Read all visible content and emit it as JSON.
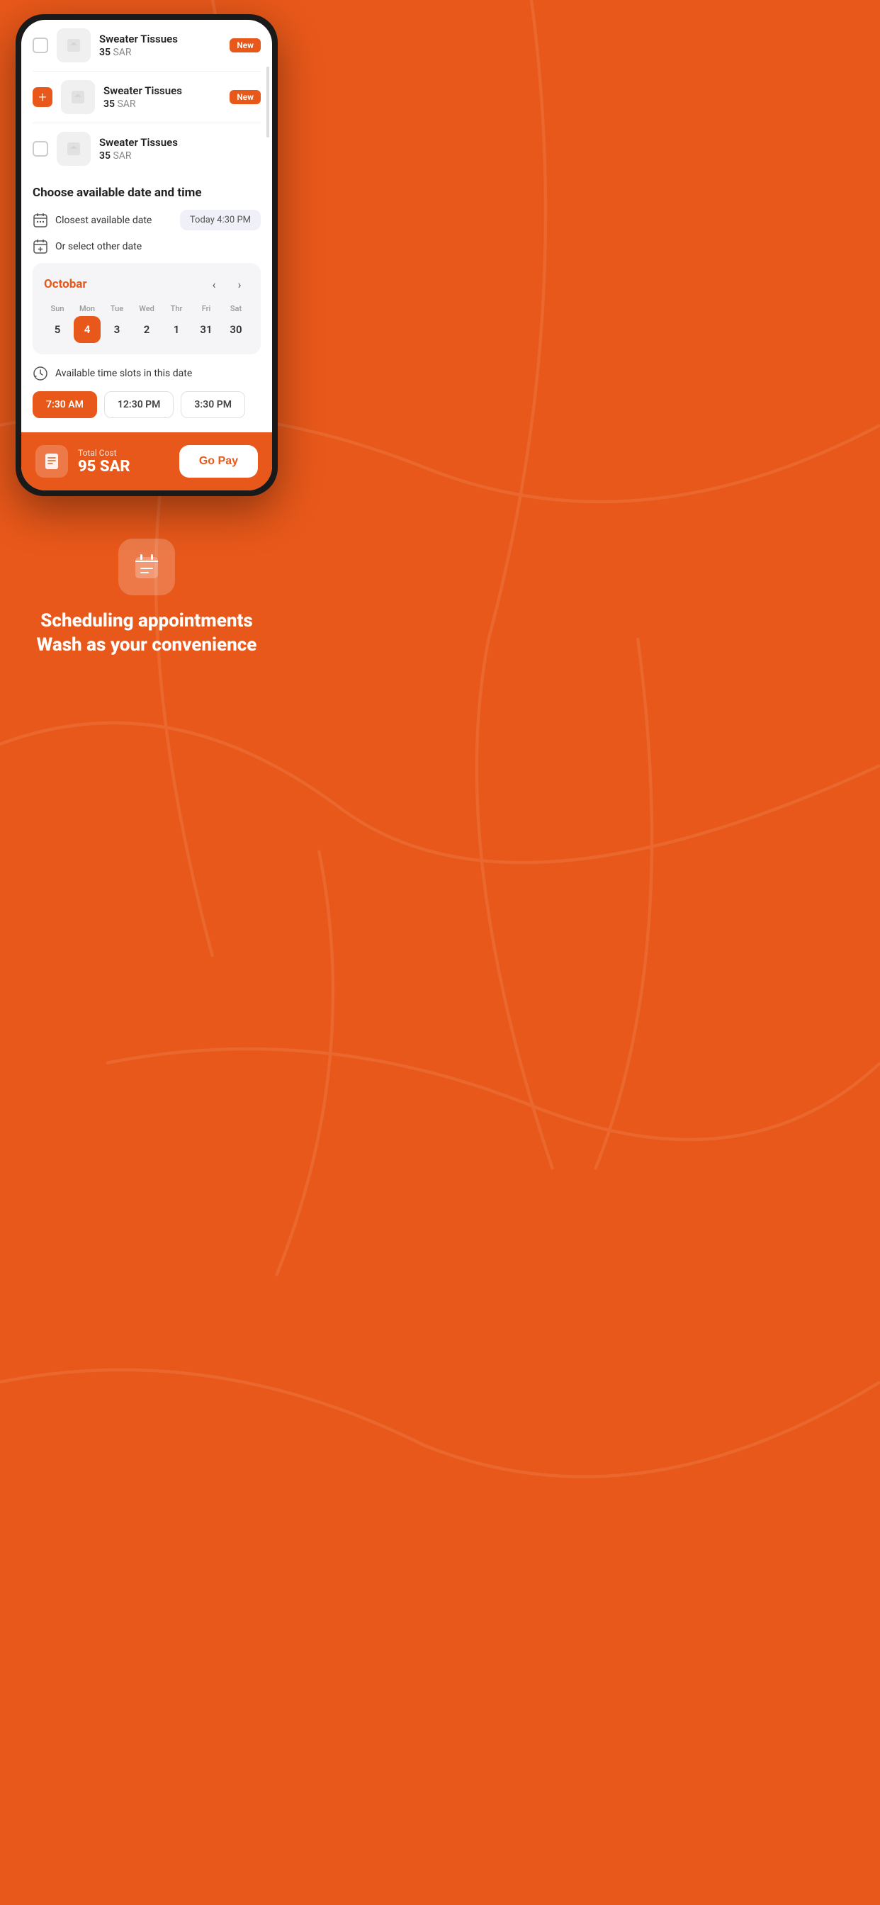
{
  "background_color": "#E8581A",
  "products": [
    {
      "name": "Sweater Tissues",
      "price": "35",
      "currency": "SAR",
      "has_checkbox": true,
      "has_add": false,
      "is_new": true,
      "show_badge": true
    },
    {
      "name": "Sweater Tissues",
      "price": "35",
      "currency": "SAR",
      "has_checkbox": false,
      "has_add": true,
      "is_new": true,
      "show_badge": true
    },
    {
      "name": "Sweater Tissues",
      "price": "35",
      "currency": "SAR",
      "has_checkbox": true,
      "has_add": false,
      "is_new": false,
      "show_badge": false
    }
  ],
  "date_section": {
    "title": "Choose available date and time",
    "closest_label": "Closest available date",
    "closest_value": "Today 4:30 PM",
    "other_date_label": "Or select other date",
    "calendar": {
      "month": "Octobar",
      "days": [
        {
          "name": "Sun",
          "num": "5",
          "selected": false
        },
        {
          "name": "Mon",
          "num": "4",
          "selected": true
        },
        {
          "name": "Tue",
          "num": "3",
          "selected": false
        },
        {
          "name": "Wed",
          "num": "2",
          "selected": false
        },
        {
          "name": "Thr",
          "num": "1",
          "selected": false
        },
        {
          "name": "Fri",
          "num": "31",
          "selected": false
        },
        {
          "name": "Sat",
          "num": "30",
          "selected": false
        }
      ]
    },
    "time_slots_label": "Available time slots in this date",
    "time_slots": [
      {
        "time": "7:30 AM",
        "active": true
      },
      {
        "time": "12:30 PM",
        "active": false
      },
      {
        "time": "3:30 PM",
        "active": false
      }
    ]
  },
  "footer": {
    "total_label": "Total Cost",
    "total_value": "95 SAR",
    "pay_button": "Go Pay"
  },
  "promo": {
    "line1": "Scheduling appointments",
    "line2": "Wash as your convenience"
  }
}
